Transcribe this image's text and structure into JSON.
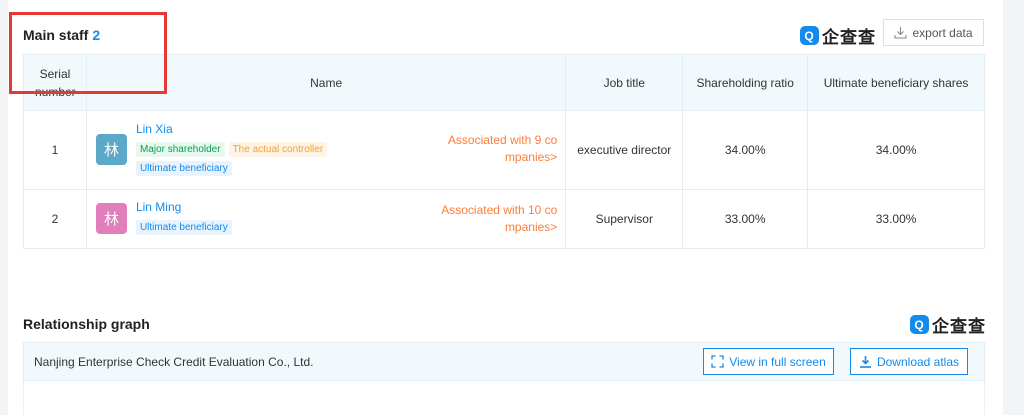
{
  "main_staff": {
    "title": "Main staff",
    "count": "2",
    "brand": "企查查",
    "brand_mark": "Q",
    "export_label": "export data",
    "columns": [
      "Serial number",
      "Name",
      "Job title",
      "Shareholding ratio",
      "Ultimate beneficiary shares"
    ],
    "rows": [
      {
        "serial": "1",
        "avatar_char": "林",
        "avatar_color": "#5ba8c8",
        "name": "Lin Xia",
        "tags": [
          "Major shareholder",
          "The actual controller",
          "Ultimate beneficiary"
        ],
        "associated": "Associated with 9 companies>",
        "job": "executive director",
        "ratio": "34.00%",
        "beneficiary": "34.00%"
      },
      {
        "serial": "2",
        "avatar_char": "林",
        "avatar_color": "#e07fbb",
        "name": "Lin Ming",
        "tags": [
          "Ultimate beneficiary"
        ],
        "associated": "Associated with 10 companies>",
        "job": "Supervisor",
        "ratio": "33.00%",
        "beneficiary": "33.00%"
      }
    ]
  },
  "relationship": {
    "title": "Relationship graph",
    "brand": "企查查",
    "brand_mark": "Q",
    "company": "Nanjing Enterprise Check Credit Evaluation Co., Ltd.",
    "fullscreen_label": "View in full screen",
    "download_label": "Download atlas"
  },
  "colors": {
    "accent": "#128bed",
    "associated": "#fd7e3a",
    "highlight": "#e53935"
  }
}
